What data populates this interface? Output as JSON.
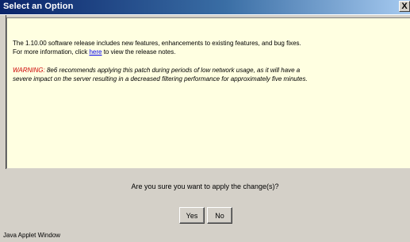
{
  "window": {
    "title": "Select an Option",
    "close_glyph": "X"
  },
  "content": {
    "para1_line1": "The 1.10.00 software release includes new features, enhancements to existing features, and bug fixes.",
    "para1_line2_prefix": "For more information, click ",
    "para1_link": "here",
    "para1_line2_suffix": " to view the release notes.",
    "warning_label": "WARNING:",
    "warning_line1_rest": " 8e6 recommends applying this patch during periods of low network usage, as it will have a",
    "warning_line2": "severe impact on the server resulting in a decreased filtering performance for approximately five minutes."
  },
  "dialog": {
    "question": "Are you sure you want to apply the change(s)?",
    "yes_label": "Yes",
    "no_label": "No"
  },
  "status_bar": {
    "text": "Java Applet Window"
  },
  "colors": {
    "titlebar_start": "#0a246a",
    "titlebar_end": "#a6caf0",
    "panel_background": "#ffffe1",
    "warning_red": "#cc0000",
    "link_blue": "#0000ee",
    "chrome_gray": "#d4d0c8"
  }
}
